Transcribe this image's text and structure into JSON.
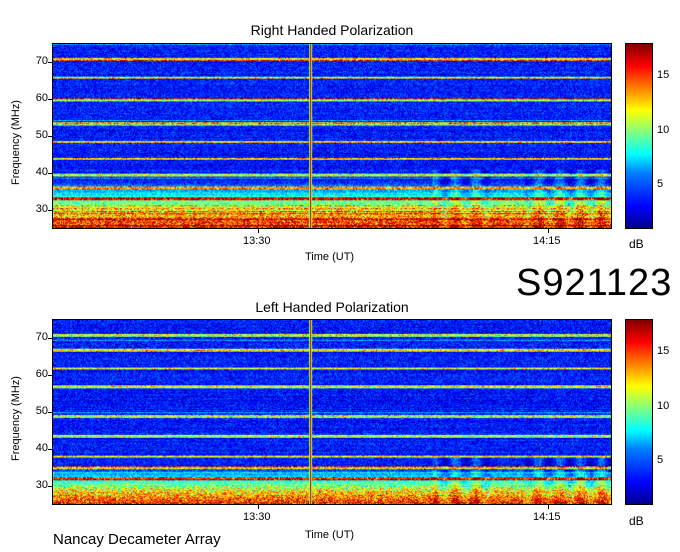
{
  "event_id": "S921123",
  "footer": "Nancay Decameter Array",
  "chart_data": [
    {
      "type": "heatmap",
      "title": "Right Handed Polarization",
      "xlabel": "Time (UT)",
      "ylabel": "Frequency (MHz)",
      "x_ticks": [
        "13:30",
        "14:15"
      ],
      "y_ticks": [
        30,
        40,
        50,
        60,
        70
      ],
      "ylim": [
        25,
        75
      ],
      "colorbar": {
        "label": "dB",
        "ticks": [
          5,
          10,
          15
        ],
        "range": [
          1,
          18
        ],
        "colormap": "jet"
      },
      "features": {
        "strong_emission_band_mhz": [
          25,
          38
        ],
        "vertical_interference_time": "13:37",
        "narrowband_rfi_lines_mhz": [
          71,
          66,
          60,
          53.5,
          48.5,
          44,
          39.5,
          36,
          33
        ]
      }
    },
    {
      "type": "heatmap",
      "title": "Left Handed Polarization",
      "xlabel": "Time (UT)",
      "ylabel": "Frequency (MHz)",
      "x_ticks": [
        "13:30",
        "14:15"
      ],
      "y_ticks": [
        30,
        40,
        50,
        60,
        70
      ],
      "ylim": [
        25,
        75
      ],
      "colorbar": {
        "label": "dB",
        "ticks": [
          5,
          10,
          15
        ],
        "range": [
          1,
          18
        ],
        "colormap": "jet"
      },
      "features": {
        "strong_emission_band_mhz": [
          25,
          35
        ],
        "vertical_interference_time": "13:37",
        "narrowband_rfi_lines_mhz": [
          71,
          67,
          62,
          57,
          49,
          43.5,
          38,
          35,
          32
        ]
      }
    }
  ]
}
